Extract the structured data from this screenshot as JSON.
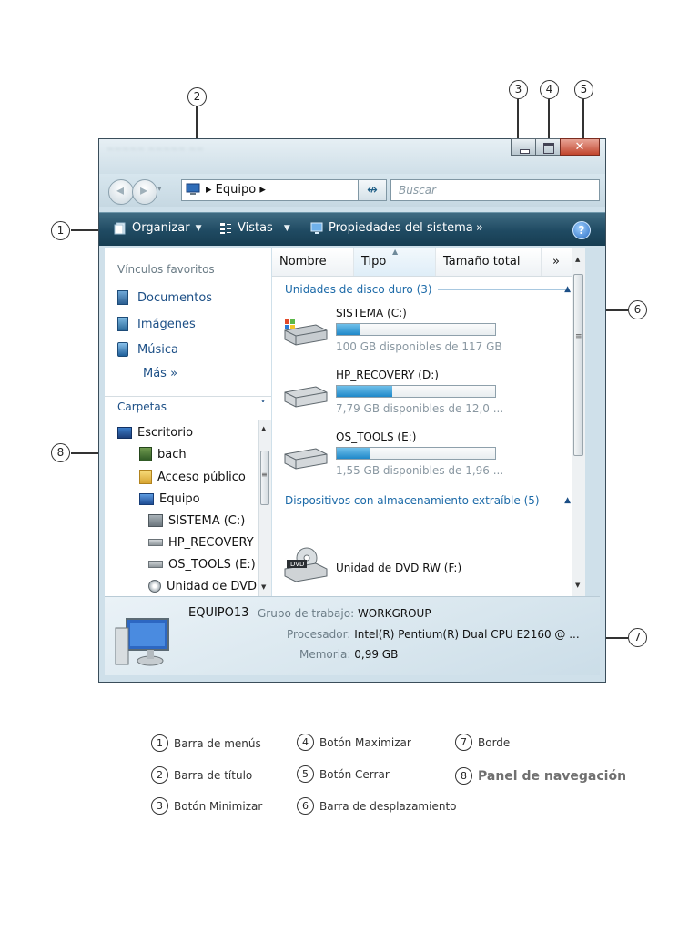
{
  "callouts": [
    "1",
    "2",
    "3",
    "4",
    "5",
    "6",
    "7",
    "8"
  ],
  "window": {
    "address": {
      "path_label": "Equipo",
      "separator": "▸"
    },
    "search": {
      "placeholder": "Buscar"
    },
    "toolbar": {
      "organize": "Organizar",
      "views": "Vistas",
      "system_properties": "Propiedades del sistema",
      "more": "»",
      "help": "?"
    },
    "nav": {
      "favorites_title": "Vínculos favoritos",
      "favorites": [
        {
          "label": "Documentos",
          "icon": "documents-icon"
        },
        {
          "label": "Imágenes",
          "icon": "pictures-icon"
        },
        {
          "label": "Música",
          "icon": "music-icon"
        }
      ],
      "more": "Más »",
      "folders_title": "Carpetas",
      "folders_chevron": "˅",
      "tree": [
        {
          "label": "Escritorio",
          "icon": "desktop-icon"
        },
        {
          "label": "bach",
          "icon": "user-folder-icon"
        },
        {
          "label": "Acceso público",
          "icon": "folder-icon"
        },
        {
          "label": "Equipo",
          "icon": "computer-icon"
        },
        {
          "label": "SISTEMA (C:)",
          "icon": "system-drive-icon"
        },
        {
          "label": "HP_RECOVERY",
          "icon": "drive-icon"
        },
        {
          "label": "OS_TOOLS (E:)",
          "icon": "drive-icon"
        },
        {
          "label": "Unidad de DVD",
          "icon": "dvd-icon"
        }
      ]
    },
    "columns": {
      "name": "Nombre",
      "type": "Tipo",
      "total": "Tamaño total",
      "more": "»"
    },
    "groups": {
      "hard_disks": "Unidades de disco duro (3)",
      "removable": "Dispositivos con almacenamiento extraíble (5)"
    },
    "drives": [
      {
        "name": "SISTEMA (C:)",
        "free": "100 GB disponibles de 117 GB",
        "used_fraction": 0.15
      },
      {
        "name": "HP_RECOVERY (D:)",
        "free": "7,79 GB disponibles de 12,0 ...",
        "used_fraction": 0.35
      },
      {
        "name": "OS_TOOLS (E:)",
        "free": "1,55 GB disponibles de 1,96 ...",
        "used_fraction": 0.21
      }
    ],
    "dvd": {
      "name": "Unidad de DVD RW (F:)",
      "badge": "DVD"
    },
    "details": {
      "computer_name": "EQUIPO13",
      "workgroup_label": "Grupo de trabajo:",
      "workgroup": "WORKGROUP",
      "processor_label": "Procesador:",
      "processor": "Intel(R) Pentium(R) Dual  CPU  E2160  @ ...",
      "memory_label": "Memoria:",
      "memory": "0,99 GB"
    }
  },
  "legend": [
    {
      "num": "1",
      "text": "Barra de menús"
    },
    {
      "num": "2",
      "text": "Barra de título"
    },
    {
      "num": "3",
      "text": "Botón Minimizar"
    },
    {
      "num": "4",
      "text": "Botón Maximizar"
    },
    {
      "num": "5",
      "text": "Botón Cerrar"
    },
    {
      "num": "6",
      "text": "Barra de desplazamiento"
    },
    {
      "num": "7",
      "text": "Borde"
    },
    {
      "num": "8",
      "text": "Panel de navegación"
    }
  ]
}
